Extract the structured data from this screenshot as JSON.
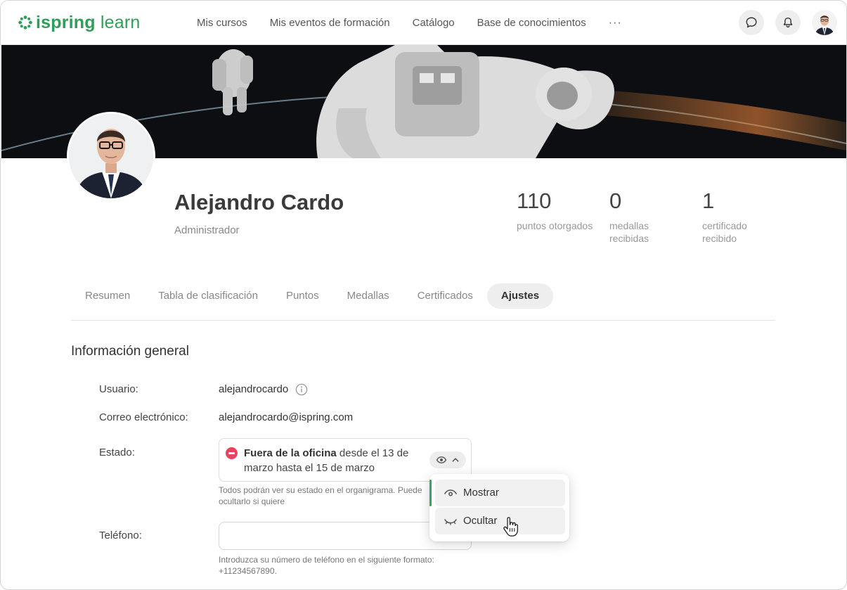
{
  "app": {
    "logo": {
      "part1": "ispring",
      "part2": "learn",
      "color": "#2f9e59"
    }
  },
  "nav": {
    "items": [
      "Mis cursos",
      "Mis eventos de formación",
      "Catálogo",
      "Base de conocimientos"
    ],
    "more": "···"
  },
  "header_icons": [
    "chat-icon",
    "bell-icon",
    "user-avatar"
  ],
  "profile": {
    "name": "Alejandro Cardo",
    "role": "Administrador",
    "stats": [
      {
        "value": "110",
        "label": "puntos otorgados"
      },
      {
        "value": "0",
        "label": "medallas recibidas"
      },
      {
        "value": "1",
        "label": "certificado recibido"
      }
    ]
  },
  "tabs": {
    "items": [
      "Resumen",
      "Tabla de clasificación",
      "Puntos",
      "Medallas",
      "Certificados",
      "Ajustes"
    ],
    "active": "Ajustes"
  },
  "section": {
    "title": "Información general",
    "username_label": "Usuario:",
    "username": "alejandrocardo",
    "email_label": "Correo electrónico:",
    "email": "alejandrocardo@ispring.com",
    "status_label": "Estado:",
    "status_bold": "Fuera de la oficina",
    "status_rest": " desde el 13 de marzo hasta el 15 de marzo",
    "status_hint_line1": "Todos podrán ver su estado en el organigrama. Puede",
    "status_hint_line2": "ocultarlo si quiere",
    "phone_label": "Teléfono:",
    "phone_value": "",
    "phone_hint_line1": "Introduzca su número de teléfono en el siguiente formato:",
    "phone_hint_line2": "+11234567890."
  },
  "visibility_menu": {
    "options": [
      {
        "label": "Mostrar",
        "icon": "eye-icon"
      },
      {
        "label": "Ocultar",
        "icon": "eye-closed-icon"
      }
    ],
    "selected": "Mostrar",
    "accent": "#2faa60"
  },
  "status_color": "#e8435d"
}
